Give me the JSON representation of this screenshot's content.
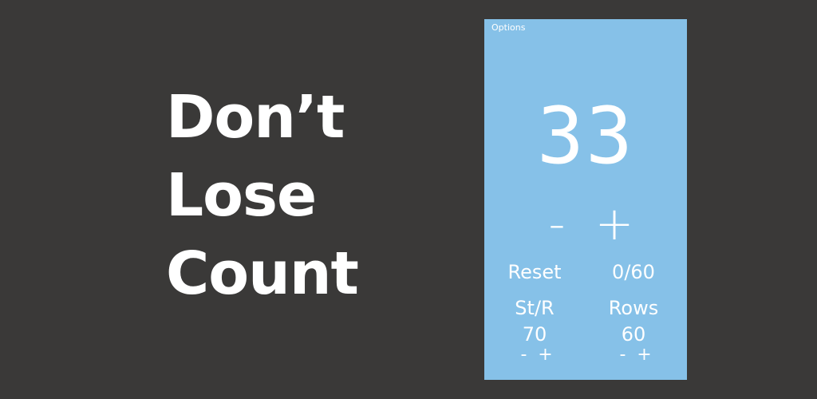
{
  "headline": [
    "Don’t",
    "Lose",
    "Count"
  ],
  "counter": {
    "options_label": "Options",
    "count": "33",
    "decrement_label": "-",
    "increment_label": "+",
    "reset_label": "Reset",
    "progress": "0/60",
    "stitches": {
      "label": "St/R",
      "value": "70",
      "minus": "-",
      "plus": "+"
    },
    "rows": {
      "label": "Rows",
      "value": "60",
      "minus": "-",
      "plus": "+"
    }
  },
  "colors": {
    "background": "#3a3938",
    "panel": "#86c1e8",
    "text": "#ffffff"
  }
}
